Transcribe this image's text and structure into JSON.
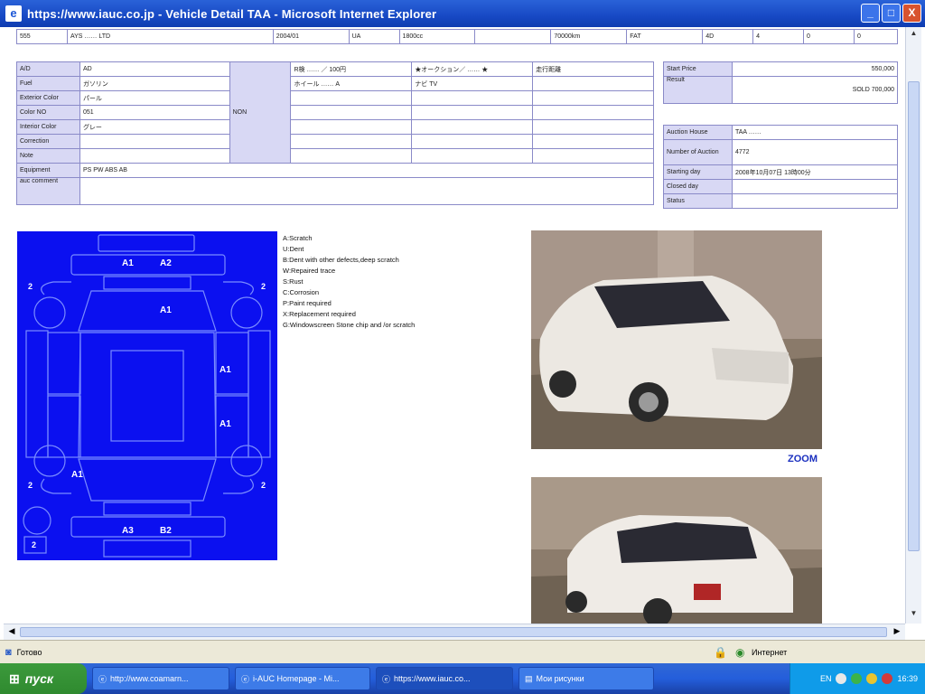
{
  "window": {
    "title": "https://www.iauc.co.jp - Vehicle Detail TAA - Microsoft Internet Explorer",
    "buttons": [
      "_",
      "□",
      "X"
    ]
  },
  "top_row": [
    "555",
    "AYS …… LTD",
    "2004/01",
    "UA",
    "1800cc",
    "",
    "70000km",
    "FAT",
    "4D",
    "4",
    "0",
    "0"
  ],
  "spec_table": {
    "rows": [
      {
        "label": "A/D",
        "value": "AD"
      },
      {
        "label": "Fuel",
        "value": "ガソリン"
      },
      {
        "label": "Exterior Color",
        "value": "パール"
      },
      {
        "label": "Color NO",
        "value": "051"
      },
      {
        "label": "Interior Color",
        "value": "グレー"
      },
      {
        "label": "Correction",
        "value": ""
      },
      {
        "label": "Note",
        "value": ""
      },
      {
        "label": "Equipment",
        "value": "PS PW ABS AB"
      },
      {
        "label": "auc comment",
        "value": ""
      }
    ],
    "mid_label": "NON",
    "grid": [
      [
        "R検 …… ／ 100円",
        "★オークション／ …… ★",
        "走行距離"
      ],
      [
        "ホイール …… A",
        "ナビ TV",
        ""
      ],
      [
        "",
        "",
        ""
      ],
      [
        "",
        "",
        ""
      ],
      [
        "",
        "",
        ""
      ],
      [
        "",
        "",
        ""
      ],
      [
        "",
        "",
        ""
      ]
    ]
  },
  "price_table": [
    {
      "label": "Start Price",
      "value": "550,000"
    },
    {
      "label": "Result",
      "value": "SOLD 700,000"
    }
  ],
  "auction_table": [
    {
      "label": "Auction House",
      "value": "TAA …… "
    },
    {
      "label": "Number of Auction",
      "value": "4772"
    },
    {
      "label": "Starting day",
      "value": "2008年10月07日 13時00分"
    },
    {
      "label": "Closed day",
      "value": ""
    },
    {
      "label": "Status",
      "value": ""
    }
  ],
  "legend": [
    "A:Scratch",
    "U:Dent",
    "B:Dent with other defects,deep scratch",
    "W:Repaired trace",
    "S:Rust",
    "C:Corrosion",
    "P:Paint required",
    "X:Replacement required",
    "G:Windowscreen Stone chip and /or scratch"
  ],
  "diagram_marks": [
    "A1",
    "A2",
    "A1",
    "A1",
    "A1",
    "A1",
    "A3",
    "B2",
    "2",
    "2",
    "2",
    "2",
    "2"
  ],
  "zoom_label": "ZOOM",
  "statusbar": {
    "left": "Готово",
    "right": "Интернет"
  },
  "taskbar": {
    "start": "пуск",
    "tasks": [
      "http://www.coamarn...",
      "i-AUC Homepage - Mi...",
      "https://www.iauc.co...",
      "Мои рисунки"
    ],
    "lang": "EN",
    "time": "16:39"
  },
  "colors": {
    "diagram": "#0b10f0",
    "label_cell": "#d8d8f4",
    "border": "#8a8ac8"
  }
}
